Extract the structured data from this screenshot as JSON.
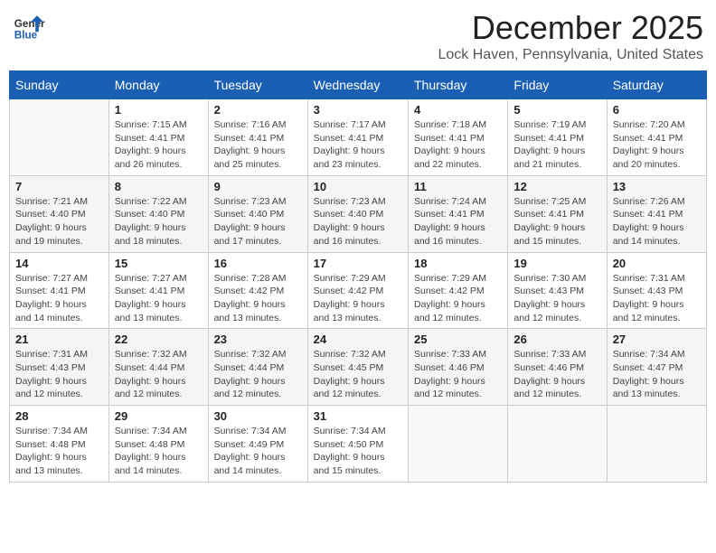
{
  "header": {
    "logo_general": "General",
    "logo_blue": "Blue",
    "month_title": "December 2025",
    "location": "Lock Haven, Pennsylvania, United States"
  },
  "days_of_week": [
    "Sunday",
    "Monday",
    "Tuesday",
    "Wednesday",
    "Thursday",
    "Friday",
    "Saturday"
  ],
  "weeks": [
    [
      {
        "date": "",
        "sunrise": "",
        "sunset": "",
        "daylight": ""
      },
      {
        "date": "1",
        "sunrise": "Sunrise: 7:15 AM",
        "sunset": "Sunset: 4:41 PM",
        "daylight": "Daylight: 9 hours and 26 minutes."
      },
      {
        "date": "2",
        "sunrise": "Sunrise: 7:16 AM",
        "sunset": "Sunset: 4:41 PM",
        "daylight": "Daylight: 9 hours and 25 minutes."
      },
      {
        "date": "3",
        "sunrise": "Sunrise: 7:17 AM",
        "sunset": "Sunset: 4:41 PM",
        "daylight": "Daylight: 9 hours and 23 minutes."
      },
      {
        "date": "4",
        "sunrise": "Sunrise: 7:18 AM",
        "sunset": "Sunset: 4:41 PM",
        "daylight": "Daylight: 9 hours and 22 minutes."
      },
      {
        "date": "5",
        "sunrise": "Sunrise: 7:19 AM",
        "sunset": "Sunset: 4:41 PM",
        "daylight": "Daylight: 9 hours and 21 minutes."
      },
      {
        "date": "6",
        "sunrise": "Sunrise: 7:20 AM",
        "sunset": "Sunset: 4:41 PM",
        "daylight": "Daylight: 9 hours and 20 minutes."
      }
    ],
    [
      {
        "date": "7",
        "sunrise": "Sunrise: 7:21 AM",
        "sunset": "Sunset: 4:40 PM",
        "daylight": "Daylight: 9 hours and 19 minutes."
      },
      {
        "date": "8",
        "sunrise": "Sunrise: 7:22 AM",
        "sunset": "Sunset: 4:40 PM",
        "daylight": "Daylight: 9 hours and 18 minutes."
      },
      {
        "date": "9",
        "sunrise": "Sunrise: 7:23 AM",
        "sunset": "Sunset: 4:40 PM",
        "daylight": "Daylight: 9 hours and 17 minutes."
      },
      {
        "date": "10",
        "sunrise": "Sunrise: 7:23 AM",
        "sunset": "Sunset: 4:40 PM",
        "daylight": "Daylight: 9 hours and 16 minutes."
      },
      {
        "date": "11",
        "sunrise": "Sunrise: 7:24 AM",
        "sunset": "Sunset: 4:41 PM",
        "daylight": "Daylight: 9 hours and 16 minutes."
      },
      {
        "date": "12",
        "sunrise": "Sunrise: 7:25 AM",
        "sunset": "Sunset: 4:41 PM",
        "daylight": "Daylight: 9 hours and 15 minutes."
      },
      {
        "date": "13",
        "sunrise": "Sunrise: 7:26 AM",
        "sunset": "Sunset: 4:41 PM",
        "daylight": "Daylight: 9 hours and 14 minutes."
      }
    ],
    [
      {
        "date": "14",
        "sunrise": "Sunrise: 7:27 AM",
        "sunset": "Sunset: 4:41 PM",
        "daylight": "Daylight: 9 hours and 14 minutes."
      },
      {
        "date": "15",
        "sunrise": "Sunrise: 7:27 AM",
        "sunset": "Sunset: 4:41 PM",
        "daylight": "Daylight: 9 hours and 13 minutes."
      },
      {
        "date": "16",
        "sunrise": "Sunrise: 7:28 AM",
        "sunset": "Sunset: 4:42 PM",
        "daylight": "Daylight: 9 hours and 13 minutes."
      },
      {
        "date": "17",
        "sunrise": "Sunrise: 7:29 AM",
        "sunset": "Sunset: 4:42 PM",
        "daylight": "Daylight: 9 hours and 13 minutes."
      },
      {
        "date": "18",
        "sunrise": "Sunrise: 7:29 AM",
        "sunset": "Sunset: 4:42 PM",
        "daylight": "Daylight: 9 hours and 12 minutes."
      },
      {
        "date": "19",
        "sunrise": "Sunrise: 7:30 AM",
        "sunset": "Sunset: 4:43 PM",
        "daylight": "Daylight: 9 hours and 12 minutes."
      },
      {
        "date": "20",
        "sunrise": "Sunrise: 7:31 AM",
        "sunset": "Sunset: 4:43 PM",
        "daylight": "Daylight: 9 hours and 12 minutes."
      }
    ],
    [
      {
        "date": "21",
        "sunrise": "Sunrise: 7:31 AM",
        "sunset": "Sunset: 4:43 PM",
        "daylight": "Daylight: 9 hours and 12 minutes."
      },
      {
        "date": "22",
        "sunrise": "Sunrise: 7:32 AM",
        "sunset": "Sunset: 4:44 PM",
        "daylight": "Daylight: 9 hours and 12 minutes."
      },
      {
        "date": "23",
        "sunrise": "Sunrise: 7:32 AM",
        "sunset": "Sunset: 4:44 PM",
        "daylight": "Daylight: 9 hours and 12 minutes."
      },
      {
        "date": "24",
        "sunrise": "Sunrise: 7:32 AM",
        "sunset": "Sunset: 4:45 PM",
        "daylight": "Daylight: 9 hours and 12 minutes."
      },
      {
        "date": "25",
        "sunrise": "Sunrise: 7:33 AM",
        "sunset": "Sunset: 4:46 PM",
        "daylight": "Daylight: 9 hours and 12 minutes."
      },
      {
        "date": "26",
        "sunrise": "Sunrise: 7:33 AM",
        "sunset": "Sunset: 4:46 PM",
        "daylight": "Daylight: 9 hours and 12 minutes."
      },
      {
        "date": "27",
        "sunrise": "Sunrise: 7:34 AM",
        "sunset": "Sunset: 4:47 PM",
        "daylight": "Daylight: 9 hours and 13 minutes."
      }
    ],
    [
      {
        "date": "28",
        "sunrise": "Sunrise: 7:34 AM",
        "sunset": "Sunset: 4:48 PM",
        "daylight": "Daylight: 9 hours and 13 minutes."
      },
      {
        "date": "29",
        "sunrise": "Sunrise: 7:34 AM",
        "sunset": "Sunset: 4:48 PM",
        "daylight": "Daylight: 9 hours and 14 minutes."
      },
      {
        "date": "30",
        "sunrise": "Sunrise: 7:34 AM",
        "sunset": "Sunset: 4:49 PM",
        "daylight": "Daylight: 9 hours and 14 minutes."
      },
      {
        "date": "31",
        "sunrise": "Sunrise: 7:34 AM",
        "sunset": "Sunset: 4:50 PM",
        "daylight": "Daylight: 9 hours and 15 minutes."
      },
      {
        "date": "",
        "sunrise": "",
        "sunset": "",
        "daylight": ""
      },
      {
        "date": "",
        "sunrise": "",
        "sunset": "",
        "daylight": ""
      },
      {
        "date": "",
        "sunrise": "",
        "sunset": "",
        "daylight": ""
      }
    ]
  ]
}
